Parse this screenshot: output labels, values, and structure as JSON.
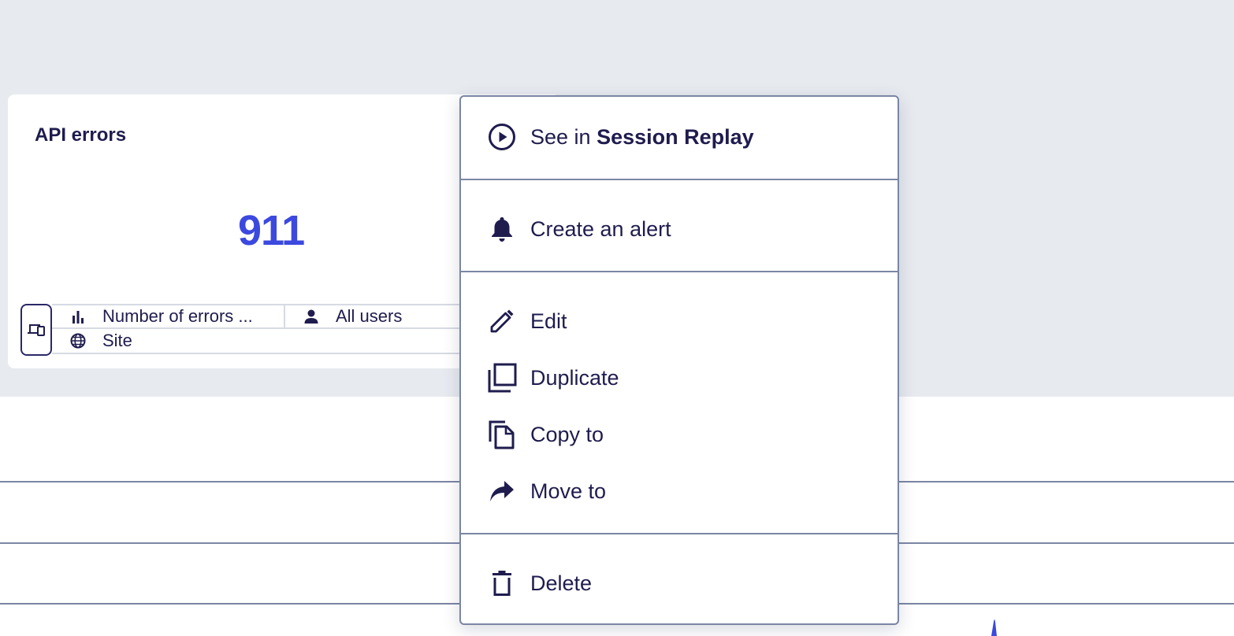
{
  "tile": {
    "title": "API errors",
    "value": "911",
    "meta": {
      "metric": "Number of errors ...",
      "audience": "All users",
      "scope": "Site",
      "source_icon": "devices-icon",
      "metric_icon": "bar-chart-icon",
      "audience_icon": "user-icon",
      "scope_icon": "globe-icon"
    }
  },
  "context_menu": {
    "session_replay": {
      "prefix": "See in",
      "target": "Session Replay",
      "icon": "play-circle-icon"
    },
    "create_alert": {
      "label": "Create an alert",
      "icon": "bell-icon"
    },
    "edit": {
      "label": "Edit",
      "icon": "pencil-icon"
    },
    "duplicate": {
      "label": "Duplicate",
      "icon": "duplicate-icon"
    },
    "copy_to": {
      "label": "Copy to",
      "icon": "copy-icon"
    },
    "move_to": {
      "label": "Move to",
      "icon": "share-arrow-icon"
    },
    "delete": {
      "label": "Delete",
      "icon": "trash-icon"
    }
  },
  "colors": {
    "accent": "#3b49df",
    "text": "#1f1c4e",
    "dashboard_bg": "#e7eaef",
    "border": "#7b86a4"
  }
}
